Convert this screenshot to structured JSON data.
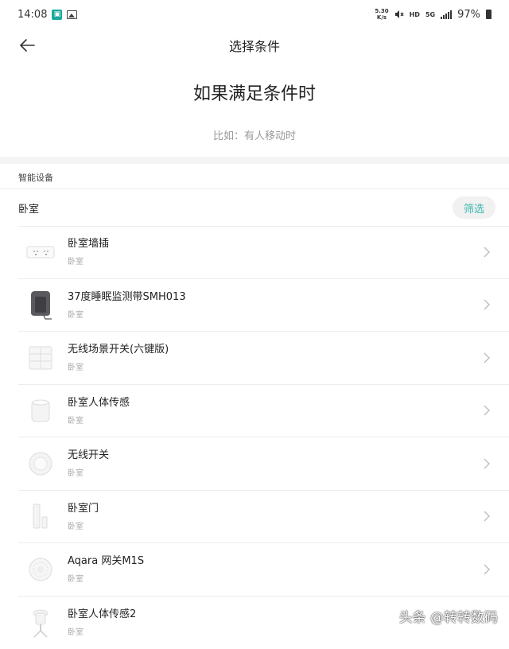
{
  "status_bar": {
    "time": "14:08",
    "net_speed_top": "5.30",
    "net_speed_bottom": "K/s",
    "hd": "HD",
    "net_type": "5G",
    "battery": "97%"
  },
  "header": {
    "title": "选择条件"
  },
  "headline": "如果满足条件时",
  "hint": "比如：有人移动时",
  "section_label": "智能设备",
  "room_filter": {
    "room": "卧室",
    "filter_label": "筛选"
  },
  "devices": [
    {
      "name": "卧室墙插",
      "room": "卧室",
      "icon": "wall-socket-icon"
    },
    {
      "name": "37度睡眠监测带SMH013",
      "room": "卧室",
      "icon": "sleep-monitor-icon"
    },
    {
      "name": "无线场景开关(六键版)",
      "room": "卧室",
      "icon": "six-key-switch-icon"
    },
    {
      "name": "卧室人体传感",
      "room": "卧室",
      "icon": "motion-sensor-icon"
    },
    {
      "name": "无线开关",
      "room": "卧室",
      "icon": "wireless-button-icon"
    },
    {
      "name": "卧室门",
      "room": "卧室",
      "icon": "door-sensor-icon"
    },
    {
      "name": "Aqara 网关M1S",
      "room": "卧室",
      "icon": "gateway-icon"
    },
    {
      "name": "卧室人体传感2",
      "room": "卧室",
      "icon": "motion-sensor-stand-icon"
    }
  ],
  "watermark": "头条 @转转数码",
  "colors": {
    "accent": "#3bb7b0",
    "app_icon": "#1aa99e"
  }
}
